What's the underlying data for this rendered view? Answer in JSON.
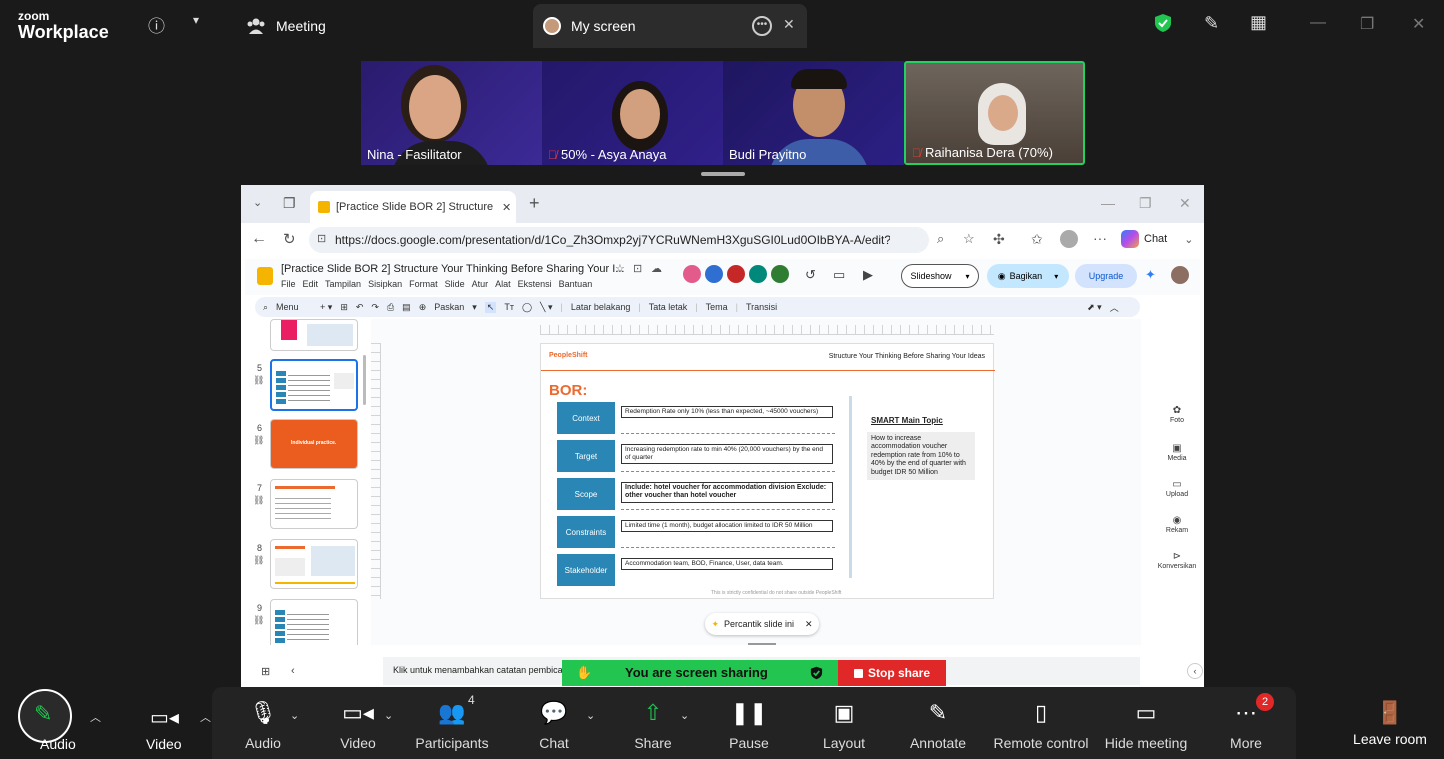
{
  "app": {
    "logo_small": "zoom",
    "logo_big": "Workplace",
    "tab_meeting": "Meeting",
    "tab_screen": "My screen"
  },
  "participants": [
    {
      "name": "Nina - Fasilitator",
      "muted": false
    },
    {
      "name": "50% - Asya Anaya",
      "muted": true
    },
    {
      "name": "Budi Prayitno",
      "muted": false
    },
    {
      "name": "Raihanisa Dera (70%)",
      "muted": true
    }
  ],
  "browser": {
    "tab_title": "[Practice Slide BOR 2] Structure Yo",
    "url": "https://docs.google.com/presentation/d/1Co_Zh3Omxp2yj7YCRuWNemH3XguSGI0Lud0OIbBYA-A/edit?sli...",
    "chat_label": "Chat"
  },
  "docs": {
    "title": "[Practice Slide BOR 2] Structure Your Thinking Before Sharing Your I...",
    "menu": [
      "File",
      "Edit",
      "Tampilan",
      "Sisipkan",
      "Format",
      "Slide",
      "Atur",
      "Alat",
      "Ekstensi",
      "Bantuan"
    ],
    "slideshow_label": "Slideshow",
    "share_label": "Bagikan",
    "upgrade_label": "Upgrade",
    "toolbar": {
      "menu_label": "Menu",
      "fit_label": "Paskan",
      "background_label": "Latar belakang",
      "layout_label": "Tata letak",
      "theme_label": "Tema",
      "transition_label": "Transisi"
    },
    "thumbs": [
      "5",
      "6",
      "7",
      "8",
      "9"
    ],
    "thumb6_text": "Individual practice.",
    "beautify_label": "Percantik slide ini",
    "notes_placeholder": "Klik untuk menambahkan catatan pembicara",
    "side_tools": [
      "Foto",
      "Media",
      "Upload",
      "Rekam",
      "Konversikan"
    ]
  },
  "slide": {
    "brand": "PeopleShift",
    "header": "Structure Your Thinking Before Sharing Your Ideas",
    "heading": "BOR:",
    "rows": [
      {
        "label": "Context",
        "text": "Redemption Rate only 10% (less than expected, ~45000 vouchers)",
        "bold": false
      },
      {
        "label": "Target",
        "text": "Increasing redemption rate to min 40% (20,000 vouchers) by the end of quarter",
        "bold": false
      },
      {
        "label": "Scope",
        "text": "Include: hotel voucher for accommodation division Exclude: other voucher than hotel voucher",
        "bold": true
      },
      {
        "label": "Constraints",
        "text": "Limited time (1 month), budget allocation limited to IDR 50 Million",
        "bold": false
      },
      {
        "label": "Stakeholder",
        "text": "Accommodation team, BOD, Finance, User, data team.",
        "bold": false
      }
    ],
    "smart_title": "SMART Main Topic",
    "smart_body": "How to increase accommodation voucher redemption rate from 10% to 40% by the end of quarter with budget IDR 50 Million",
    "footer": "This is strictly confidential do not share outside PeopleShift"
  },
  "share_banner": {
    "text": "You are screen sharing",
    "stop": "Stop share"
  },
  "controls": {
    "audio_left": "Audio",
    "video_left": "Video",
    "audio": "Audio",
    "video": "Video",
    "participants": "Participants",
    "participants_count": "4",
    "chat": "Chat",
    "share": "Share",
    "pause": "Pause",
    "layout": "Layout",
    "annotate": "Annotate",
    "remote_control": "Remote control",
    "hide_meeting": "Hide meeting",
    "more": "More",
    "more_badge": "2",
    "leave": "Leave room"
  },
  "colors": {
    "accent_green": "#23c551",
    "stop_red": "#e02828",
    "slide_blue": "#2a86b4",
    "slide_orange": "#ea6a2f"
  }
}
